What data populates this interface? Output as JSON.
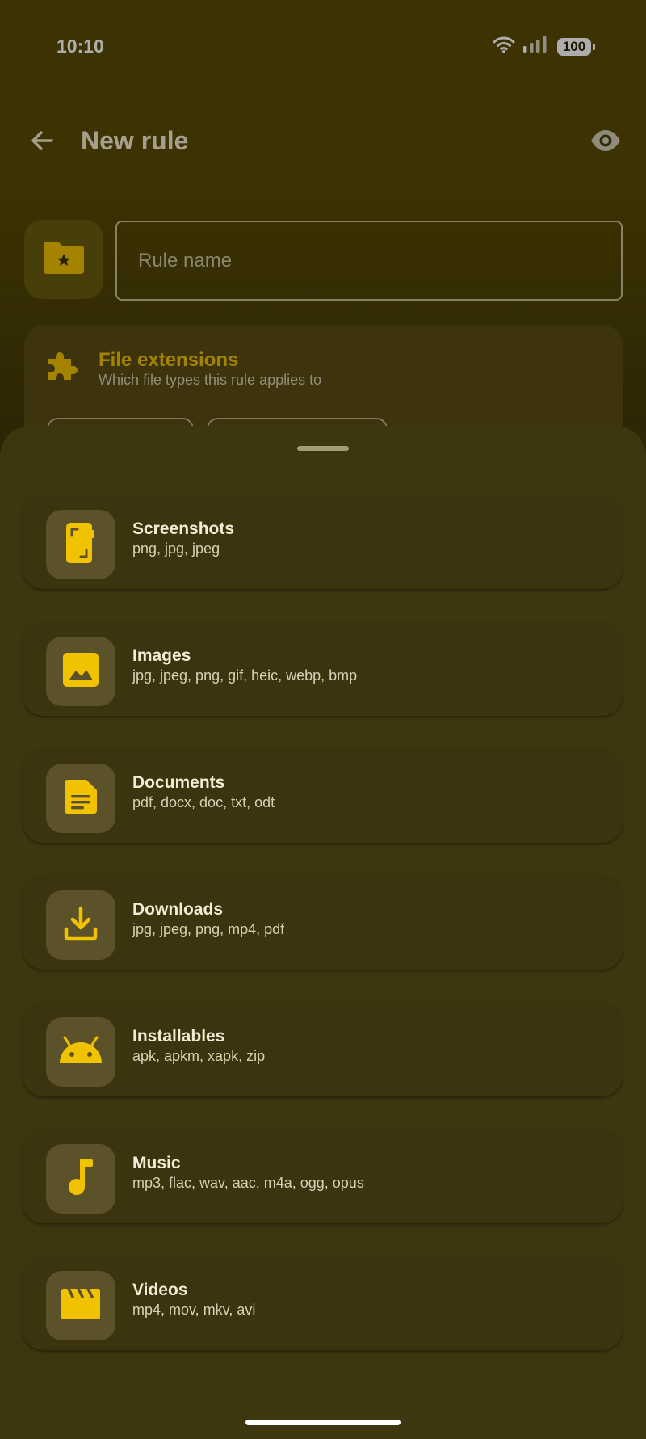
{
  "status_bar": {
    "time": "10:10",
    "battery": "100",
    "icons": [
      "wifi-icon",
      "signal-icon",
      "battery-icon"
    ]
  },
  "app_bar": {
    "title": "New rule",
    "back_icon": "arrow-back-icon",
    "preview_icon": "eye-icon"
  },
  "rule_name": {
    "value": "",
    "placeholder": "Rule name",
    "folder_icon": "folder-star-icon"
  },
  "file_extensions": {
    "title": "File extensions",
    "subtitle": "Which file types this rule applies to",
    "icon": "puzzle-icon"
  },
  "preset_sheet": {
    "items": [
      {
        "title": "Screenshots",
        "extensions": "png, jpg, jpeg",
        "icon": "screenshot-icon"
      },
      {
        "title": "Images",
        "extensions": "jpg, jpeg, png, gif, heic, webp, bmp",
        "icon": "image-icon"
      },
      {
        "title": "Documents",
        "extensions": "pdf, docx, doc, txt, odt",
        "icon": "document-icon"
      },
      {
        "title": "Downloads",
        "extensions": "jpg, jpeg, png, mp4, pdf",
        "icon": "download-icon"
      },
      {
        "title": "Installables",
        "extensions": "apk, apkm, xapk, zip",
        "icon": "android-icon"
      },
      {
        "title": "Music",
        "extensions": "mp3, flac, wav, aac, m4a, ogg, opus",
        "icon": "music-note-icon"
      },
      {
        "title": "Videos",
        "extensions": "mp4, mov, mkv, avi",
        "icon": "clapperboard-icon"
      }
    ]
  },
  "colors": {
    "accent": "#f1c200",
    "sheet_background": "#3d360f",
    "icon_tile": "#5c5229"
  }
}
